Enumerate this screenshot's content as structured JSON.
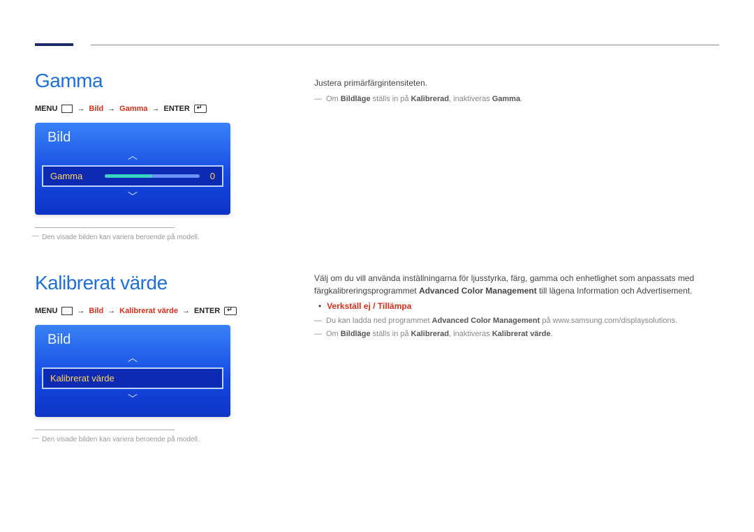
{
  "section1": {
    "title": "Gamma",
    "menu_path": {
      "menu": "MENU",
      "p1": "Bild",
      "p2": "Gamma",
      "enter": "ENTER"
    },
    "osd": {
      "panel_title": "Bild",
      "row_label": "Gamma",
      "row_value": "0"
    },
    "footnote": "Den visade bilden kan variera beroende på modell.",
    "right": {
      "line1": "Justera primärfärgintensiteten.",
      "note1_pre": "Om ",
      "note1_b1": "Bildläge",
      "note1_mid": " ställs in på ",
      "note1_b2": "Kalibrerad",
      "note1_post": ", inaktiveras ",
      "note1_b3": "Gamma",
      "note1_end": "."
    }
  },
  "section2": {
    "title": "Kalibrerat värde",
    "menu_path": {
      "menu": "MENU",
      "p1": "Bild",
      "p2": "Kalibrerat värde",
      "enter": "ENTER"
    },
    "osd": {
      "panel_title": "Bild",
      "row_label": "Kalibrerat värde"
    },
    "footnote": "Den visade bilden kan variera beroende på modell.",
    "right": {
      "para1a": "Välj om du vill använda inställningarna för ljusstyrka, färg, gamma och enhetlighet som anpassats med färgkalibreringsprogrammet ",
      "para1b": "Advanced Color Management",
      "para1c": " till lägena Information och Advertisement.",
      "bullet": "Verkställ ej / Tillämpa",
      "note1_pre": "Du kan ladda ned programmet ",
      "note1_b": "Advanced Color Management",
      "note1_post": " på www.samsung.com/displaysolutions.",
      "note2_pre": "Om ",
      "note2_b1": "Bildläge",
      "note2_mid": " ställs in på ",
      "note2_b2": "Kalibrerad",
      "note2_post": ", inaktiveras ",
      "note2_b3": "Kalibrerat värde",
      "note2_end": "."
    }
  }
}
